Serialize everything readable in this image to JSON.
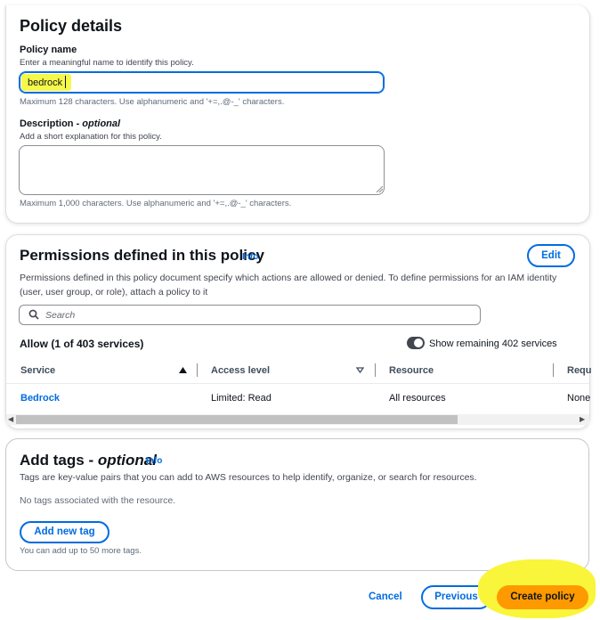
{
  "policy_details": {
    "title": "Policy details",
    "name_label": "Policy name",
    "name_description": "Enter a meaningful name to identify this policy.",
    "name_value": "bedrock",
    "name_constraint": "Maximum 128 characters. Use alphanumeric and '+=,.@-_' characters.",
    "description_label": "Description - ",
    "description_optional": "optional",
    "description_hint": "Add a short explanation for this policy.",
    "description_value": "",
    "description_constraint": "Maximum 1,000 characters. Use alphanumeric and '+=,.@-_' characters."
  },
  "permissions": {
    "title": "Permissions defined in this policy",
    "info": "Info",
    "edit_label": "Edit",
    "description": "Permissions defined in this policy document specify which actions are allowed or denied. To define permissions for an IAM identity (user, user group, or role), attach a policy to it",
    "search_placeholder": "Search",
    "allow_summary": "Allow (1 of 403 services)",
    "toggle_label": "Show remaining 402 services",
    "toggle_on": false,
    "columns": [
      "Service",
      "Access level",
      "Resource",
      "Requ"
    ],
    "rows": [
      {
        "service": "Bedrock",
        "access_level": "Limited: Read",
        "resource": "All resources",
        "request": "None"
      }
    ]
  },
  "tags": {
    "title": "Add tags - ",
    "title_optional": "optional",
    "info": "Info",
    "description": "Tags are key-value pairs that you can add to AWS resources to help identify, organize, or search for resources.",
    "empty_text": "No tags associated with the resource.",
    "add_label": "Add new tag",
    "limit_hint": "You can add up to 50 more tags."
  },
  "footer": {
    "cancel_label": "Cancel",
    "previous_label": "Previous",
    "create_label": "Create policy"
  },
  "colors": {
    "link": "#006ce0",
    "primary_button": "#ff9900",
    "highlight": "#f9f53a"
  },
  "icons": [
    "search-icon",
    "sort-ascending-icon",
    "sort-descending-icon",
    "toggle-switch",
    "resize-grip-icon",
    "scroll-left-icon",
    "scroll-right-icon"
  ]
}
